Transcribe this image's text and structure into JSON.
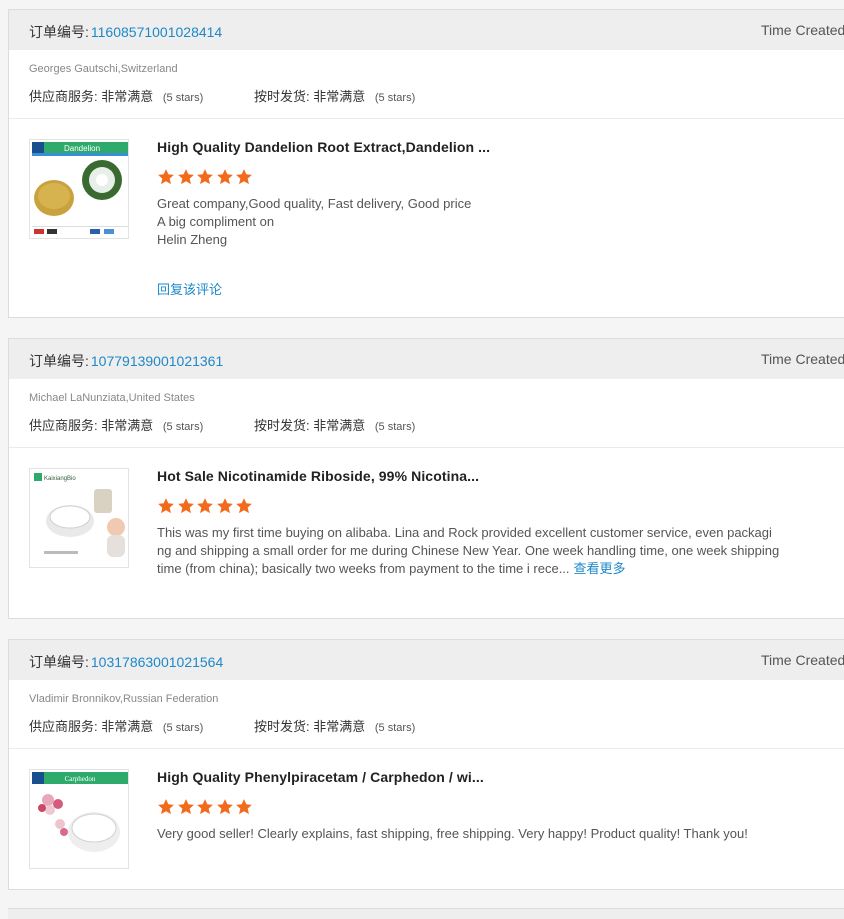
{
  "labels": {
    "order_number": "订单编号:",
    "time_created": "Time Created",
    "supplier_service": "供应商服务:",
    "on_time_delivery": "按时发货:",
    "very_satisfied": "非常满意",
    "reply": "回复该评论",
    "see_more": "查看更多"
  },
  "reviews": [
    {
      "order_number": "11608571001028414",
      "buyer": "Georges Gautschi,Switzerland",
      "supplier_stars_note": "(5 stars)",
      "delivery_stars_note": "(5 stars)",
      "product_title": "High Quality Dandelion Root Extract,Dandelion ...",
      "rating": 5,
      "review_lines": [
        "Great company,Good quality, Fast delivery, Good price",
        "A big compliment on",
        "Helin Zheng"
      ],
      "has_reply": true,
      "has_more": false,
      "thumb_label": "Dandelion",
      "thumb_icon": "dandelion-extract-image"
    },
    {
      "order_number": "10779139001021361",
      "buyer": "Michael LaNunziata,United States",
      "supplier_stars_note": "(5 stars)",
      "delivery_stars_note": "(5 stars)",
      "product_title": "Hot Sale Nicotinamide Riboside, 99% Nicotina...",
      "rating": 5,
      "review_lines": [
        "This was my first time buying on alibaba.  Lina and Rock provided excellent customer service, even packagi",
        "ng and shipping a small order for me during Chinese New Year. One week handling time, one week shipping",
        "time (from china); basically two weeks from payment to the time i rece..."
      ],
      "has_reply": false,
      "has_more": true,
      "thumb_label": "KaixiangBio",
      "thumb_icon": "nicotinamide-riboside-image"
    },
    {
      "order_number": "10317863001021564",
      "buyer": "Vladimir Bronnikov,Russian Federation",
      "supplier_stars_note": "(5 stars)",
      "delivery_stars_note": "(5 stars)",
      "product_title": "High Quality Phenylpiracetam / Carphedon / wi...",
      "rating": 5,
      "review_lines": [
        "Very good seller! Clearly explains, fast shipping, free shipping. Very happy! Product quality! Thank you!"
      ],
      "has_reply": false,
      "has_more": false,
      "thumb_label": "Carphedon",
      "thumb_icon": "carphedon-image"
    }
  ],
  "colors": {
    "accent_link": "#1e88c8",
    "star": "#f26b1d",
    "header_bg": "#eeeeee"
  }
}
